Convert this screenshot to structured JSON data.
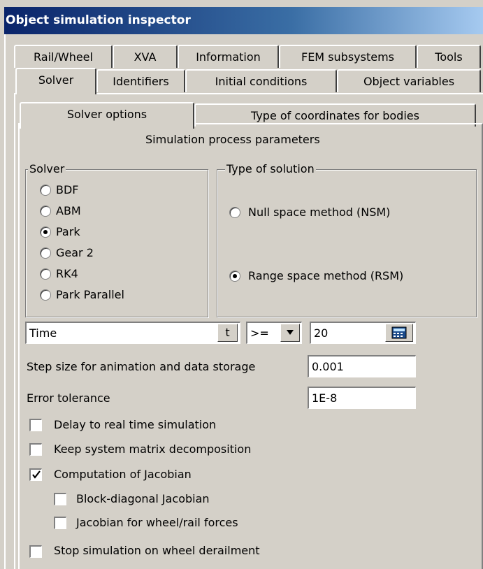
{
  "window": {
    "title": "Object simulation inspector"
  },
  "tabs_row1": [
    "Rail/Wheel",
    "XVA",
    "Information",
    "FEM subsystems",
    "Tools"
  ],
  "tabs_row2": [
    "Solver",
    "Identifiers",
    "Initial conditions",
    "Object variables"
  ],
  "subtabs": [
    "Solver options",
    "Type of coordinates for bodies"
  ],
  "section_title": "Simulation process parameters",
  "solver_group": {
    "legend": "Solver",
    "options": [
      "BDF",
      "ABM",
      "Park",
      "Gear 2",
      "RK4",
      "Park Parallel"
    ],
    "selected": "Park"
  },
  "solution_group": {
    "legend": "Type of solution",
    "options": [
      "Null space method (NSM)",
      "Range space method (RSM)"
    ],
    "selected": "Range space method (RSM)"
  },
  "stop_condition": {
    "variable": "Time",
    "variable_button": "t",
    "operator": ">=",
    "value": "20",
    "calculator_icon": "calculator-icon"
  },
  "step_size": {
    "label": "Step size for animation and data storage",
    "value": "0.001"
  },
  "error_tolerance": {
    "label": "Error tolerance",
    "value": "1E-8"
  },
  "checkboxes": {
    "delay_realtime": {
      "label": "Delay to real time simulation",
      "checked": false
    },
    "keep_matrix": {
      "label": "Keep system matrix decomposition",
      "checked": false
    },
    "jacobian": {
      "label": "Computation of Jacobian",
      "checked": true
    },
    "block_diagonal": {
      "label": "Block-diagonal Jacobian",
      "checked": false
    },
    "wheel_rail_jacobian": {
      "label": "Jacobian for wheel/rail forces",
      "checked": false
    },
    "stop_derailment": {
      "label": "Stop simulation on wheel derailment",
      "checked": false
    }
  },
  "colors": {
    "title_start": "#0a246a",
    "title_end": "#a6caf0",
    "face": "#d4d0c8"
  }
}
